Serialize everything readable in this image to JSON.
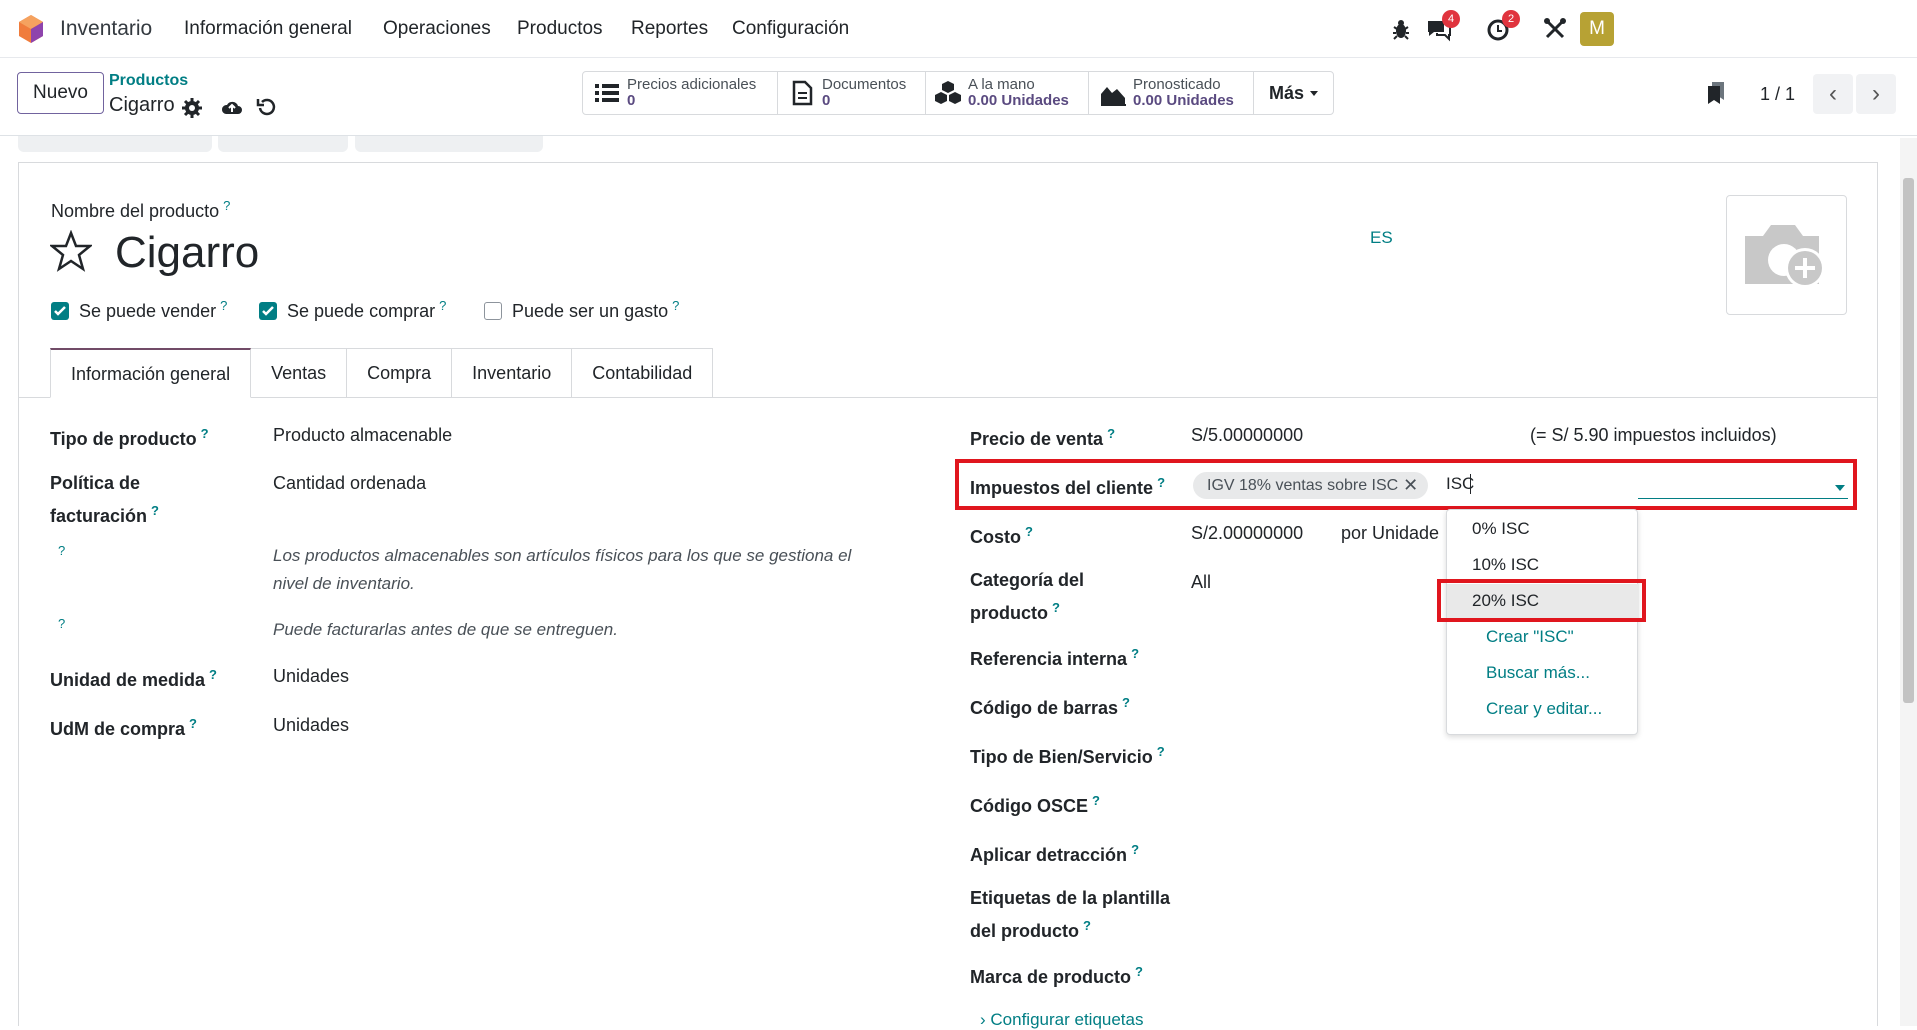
{
  "app": {
    "name": "Inventario",
    "menu": [
      "Información general",
      "Operaciones",
      "Productos",
      "Reportes",
      "Configuración"
    ],
    "chat_badge": "4",
    "activity_badge": "2",
    "avatar_letter": "M"
  },
  "control": {
    "new_button": "Nuevo",
    "breadcrumb_parent": "Productos",
    "breadcrumb_current": "Cigarro",
    "smart_buttons": [
      {
        "label": "Precios adicionales",
        "value": "0",
        "icon": "list-icon"
      },
      {
        "label": "Documentos",
        "value": "0",
        "icon": "document-icon"
      },
      {
        "label": "A la mano",
        "value": "0.00 Unidades",
        "icon": "cubes-icon"
      },
      {
        "label": "Pronosticado",
        "value": "0.00 Unidades",
        "icon": "area-chart-icon"
      }
    ],
    "more_label": "Más",
    "pager": "1 / 1"
  },
  "product": {
    "name_label": "Nombre del producto",
    "name": "Cigarro",
    "lang": "ES",
    "checkboxes": [
      {
        "label": "Se puede vender",
        "checked": true
      },
      {
        "label": "Se puede comprar",
        "checked": true
      },
      {
        "label": "Puede ser un gasto",
        "checked": false
      }
    ]
  },
  "tabs": [
    "Información general",
    "Ventas",
    "Compra",
    "Inventario",
    "Contabilidad"
  ],
  "left_fields": {
    "tipo_label": "Tipo de producto",
    "tipo_value": "Producto almacenable",
    "politica_label_1": "Política de",
    "politica_label_2": "facturación",
    "politica_value": "Cantidad ordenada",
    "hint_1a": "Los productos almacenables son artículos físicos para los que se gestiona el",
    "hint_1b": "nivel de inventario.",
    "hint_2": "Puede facturarlas antes de que se entreguen.",
    "udm_label": "Unidad de medida",
    "udm_value": "Unidades",
    "udm_compra_label": "UdM de compra",
    "udm_compra_value": "Unidades"
  },
  "right_fields": {
    "precio_label": "Precio de venta",
    "precio_value": "S/5.00000000",
    "precio_note": "(= S/ 5.90 impuestos incluidos)",
    "impuestos_label": "Impuestos del cliente",
    "impuestos_tag": "IGV 18% ventas sobre ISC",
    "impuestos_typed": "ISC",
    "costo_label": "Costo",
    "costo_value": "S/2.00000000",
    "costo_unit": "por Unidade",
    "categoria_label_1": "Categoría del",
    "categoria_label_2": "producto",
    "categoria_value": "All",
    "ref_label": "Referencia interna",
    "barcode_label": "Código de barras",
    "tipo_bien_label": "Tipo de Bien/Servicio",
    "osce_label": "Código OSCE",
    "detraccion_label": "Aplicar detracción",
    "etiquetas_label_1": "Etiquetas de la plantilla",
    "etiquetas_label_2": "del producto",
    "marca_label": "Marca de producto",
    "config_link": "Configurar etiquetas"
  },
  "dropdown": {
    "options": [
      "0% ISC",
      "10% ISC",
      "20% ISC"
    ],
    "highlighted": "20% ISC",
    "actions": [
      "Crear \"ISC\"",
      "Buscar más...",
      "Crear y editar..."
    ]
  },
  "colors": {
    "accent": "#017e84",
    "brand": "#714b67",
    "highlight_box": "#e0161e"
  }
}
